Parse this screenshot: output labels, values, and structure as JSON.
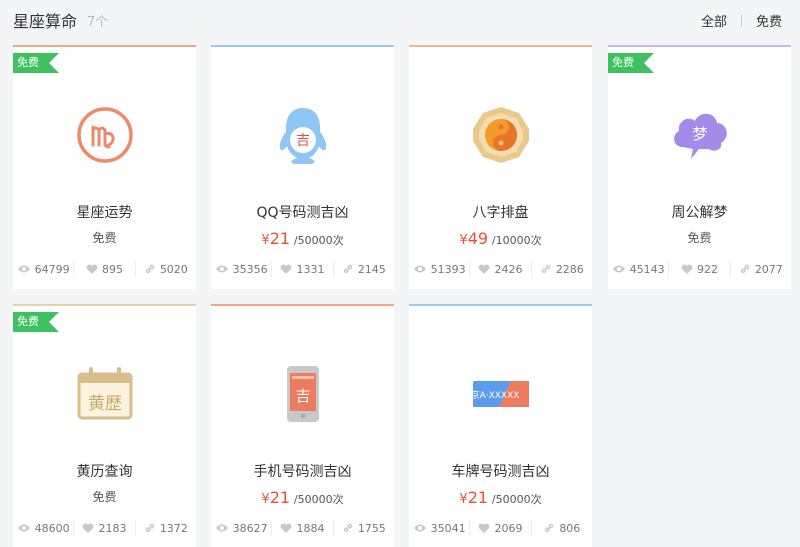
{
  "header": {
    "title": "星座算命",
    "count": "7个",
    "filters": [
      "全部",
      "免费"
    ]
  },
  "colors": {
    "free_ribbon": "#3fc162",
    "price": "#e8503a"
  },
  "cards": [
    {
      "name": "星座运势",
      "free_badge": "免费",
      "price_text": "免费",
      "views": "64799",
      "likes": "895",
      "shares": "5020",
      "icon": "virgo-zodiac-icon"
    },
    {
      "name": "QQ号码测吉凶",
      "currency": "¥",
      "price": "21",
      "unit": "/50000次",
      "views": "35356",
      "likes": "1331",
      "shares": "2145",
      "icon": "qq-penguin-icon",
      "icon_text": "吉"
    },
    {
      "name": "八字排盘",
      "currency": "¥",
      "price": "49",
      "unit": "/10000次",
      "views": "51393",
      "likes": "2426",
      "shares": "2286",
      "icon": "yin-yang-bagua-icon"
    },
    {
      "name": "周公解梦",
      "free_badge": "免费",
      "price_text": "免费",
      "views": "45143",
      "likes": "922",
      "shares": "2077",
      "icon": "dream-cloud-icon",
      "icon_text": "梦"
    },
    {
      "name": "黄历查询",
      "free_badge": "免费",
      "price_text": "免费",
      "views": "48600",
      "likes": "2183",
      "shares": "1372",
      "icon": "almanac-calendar-icon",
      "icon_text": "黄歴"
    },
    {
      "name": "手机号码测吉凶",
      "currency": "¥",
      "price": "21",
      "unit": "/50000次",
      "views": "38627",
      "likes": "1884",
      "shares": "1755",
      "icon": "mobile-phone-icon",
      "icon_text": "吉"
    },
    {
      "name": "车牌号码测吉凶",
      "currency": "¥",
      "price": "21",
      "unit": "/50000次",
      "views": "35041",
      "likes": "2069",
      "shares": "806",
      "icon": "license-plate-icon",
      "icon_text": "京A·XXXXX"
    }
  ]
}
